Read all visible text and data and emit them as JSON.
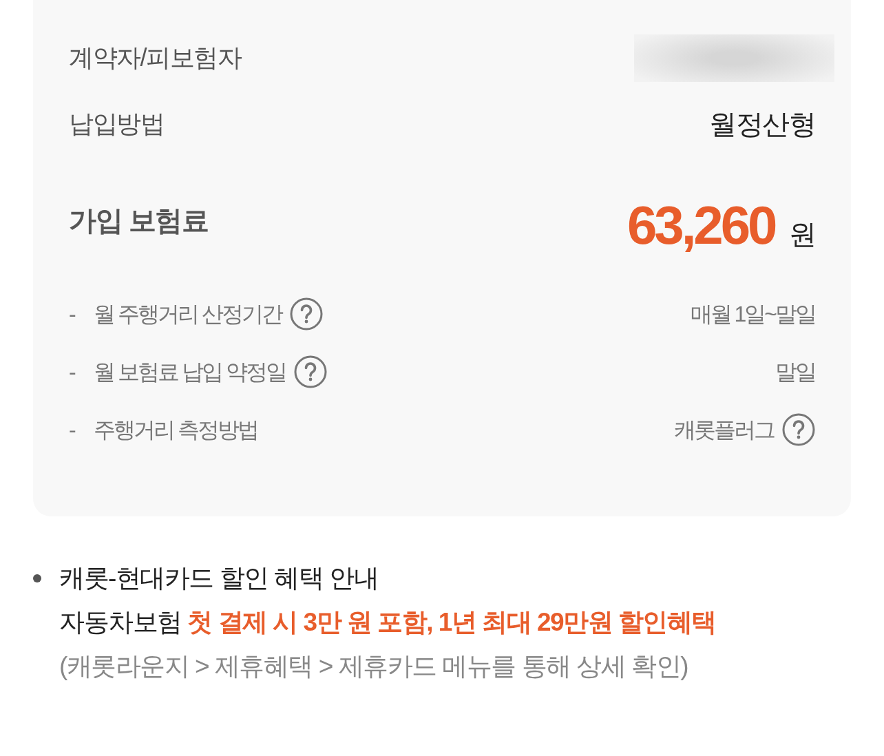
{
  "summary_card": {
    "rows": [
      {
        "kind": "redacted",
        "label": "계약자/피보험자"
      },
      {
        "kind": "text",
        "label": "납입방법",
        "value": "월정산형"
      }
    ],
    "premium": {
      "label": "가입 보험료",
      "amount": "63,260",
      "unit": "원"
    },
    "details": [
      {
        "marker": "-",
        "label": "월 주행거리 산정기간",
        "label_help": true,
        "value": "매월 1일~말일",
        "value_help": false
      },
      {
        "marker": "-",
        "label": "월 보험료 납입 약정일",
        "label_help": true,
        "value": "말일",
        "value_help": false
      },
      {
        "marker": "-",
        "label": "주행거리 측정방법",
        "label_help": false,
        "value": "캐롯플러그",
        "value_help": true
      }
    ]
  },
  "notice": {
    "title": "캐롯-현대카드 할인 혜택 안내",
    "benefit": "자동차보험 **첫 결제 시 3만 원 포함, 1년 최대 29만원 할인혜택**",
    "path_note": "(캐롯라운지 > 제휴혜택 > 제휴카드 메뉴를 통해 상세 확인)"
  }
}
